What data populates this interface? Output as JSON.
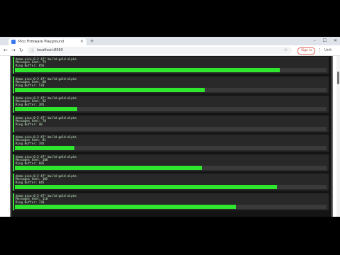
{
  "browser": {
    "tab_title": "Pico Firmware Playground",
    "tab_close": "×",
    "new_tab": "+",
    "controls": {
      "minimize": "–",
      "maximize": "☐",
      "close": "✕"
    },
    "url": "localhost:8080",
    "omnibox_info": "ⓘ",
    "signin_label": "Sign in",
    "nav": {
      "back": "←",
      "forward": "→",
      "reload": "↻"
    },
    "menu": "⋮",
    "extra": "Unit"
  },
  "cards": [
    {
      "title": "demo-pico-0-2 47° build-gold-alpha",
      "messages": "Messages Sent: 75",
      "buffer": "Ring Buffer: 856",
      "level": 0.85
    },
    {
      "title": "demo-pico-0-2 47° build-gold-alpha",
      "messages": "Messages Sent: 88",
      "buffer": "Ring Buffer: 578",
      "level": 0.61
    },
    {
      "title": "demo-pico-0-2 47° build-gold-alpha",
      "messages": "Messages Sent: 92",
      "buffer": "Ring Buffer: 205",
      "level": 0.2
    },
    {
      "title": "demo-pico-0-2 47° build-gold-alpha",
      "messages": "Messages Sent: 70",
      "buffer": "Ring Buffer: 40",
      "level": 0.0
    },
    {
      "title": "demo-pico-0-2 47° build-gold-alpha",
      "messages": "Messages Sent: 91",
      "buffer": "Ring Buffer: 195",
      "level": 0.19
    },
    {
      "title": "demo-pico-0-2 47° build-gold-alpha",
      "messages": "Messages Sent: 100",
      "buffer": "Ring Buffer: 605",
      "level": 0.6
    },
    {
      "title": "demo-pico-0-2 47° build-gold-alpha",
      "messages": "Messages Sent: 105",
      "buffer": "Ring Buffer: 845",
      "level": 0.84
    },
    {
      "title": "demo-pico-0-2 47° build-gold-alpha",
      "messages": "Messages Sent: 110",
      "buffer": "Ring Buffer: 720",
      "level": 0.71
    }
  ]
}
